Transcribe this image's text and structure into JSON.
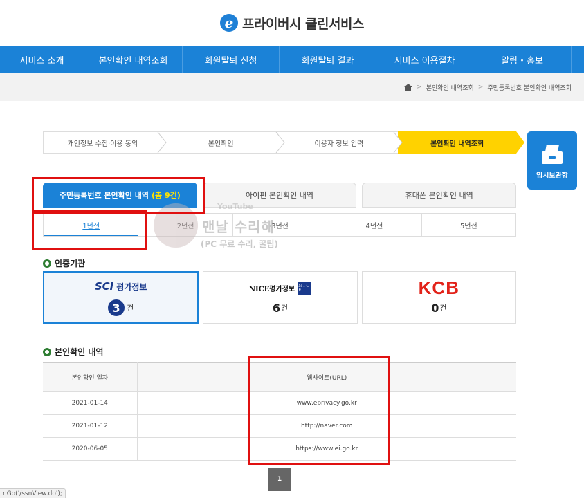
{
  "header": {
    "logo_letter": "e",
    "site_title": "프라이버시 클린서비스"
  },
  "nav": {
    "items": [
      "서비스 소개",
      "본인확인 내역조회",
      "회원탈퇴 신청",
      "회원탈퇴 결과",
      "서비스 이용절차",
      "알림・홍보"
    ]
  },
  "breadcrumb": {
    "items": [
      "본인확인 내역조회",
      "주민등록번호 본인확인 내역조회"
    ]
  },
  "steps": [
    "개인정보 수집·이용 동의",
    "본인확인",
    "이용자 정보 입력",
    "본인확인 내역조회"
  ],
  "side_box": {
    "label": "임시보관함",
    "icon": "drawer-icon"
  },
  "tabs": {
    "t1": "주민등록번호 본인확인 내역",
    "t1_count": "(총 9건)",
    "t2": "아이핀 본인확인 내역",
    "t3": "휴대폰 본인확인 내역"
  },
  "years": [
    "1년전",
    "2년전",
    "3년전",
    "4년전",
    "5년전"
  ],
  "watermark": {
    "top": "YouTube",
    "title": "맨날 수리해",
    "sub": "(PC 무료 수리, 꿀팁)"
  },
  "agency_section": {
    "title": "인증기관"
  },
  "agencies": {
    "sci": {
      "mark": "SCI",
      "name": "평가정보",
      "count": "3",
      "unit": "건"
    },
    "nice": {
      "name": "NICE평가정보",
      "box": "N I C E",
      "count": "6",
      "unit": "건"
    },
    "kcb": {
      "name": "KCB",
      "count": "0",
      "unit": "건"
    }
  },
  "history_section": {
    "title": "본인확인 내역"
  },
  "history": {
    "col_date": "본인확인 일자",
    "col_url": "웹사이트(URL)",
    "rows": [
      {
        "date": "2021-01-14",
        "url": "www.eprivacy.go.kr"
      },
      {
        "date": "2021-01-12",
        "url": "http://naver.com"
      },
      {
        "date": "2020-06-05",
        "url": "https://www.ei.go.kr"
      }
    ]
  },
  "pagination": {
    "current": "1"
  },
  "status_bar": {
    "text": "nGo('/ssnView.do');"
  },
  "colors": {
    "primary": "#1b82d7",
    "highlight": "#ffd200",
    "annotation": "#e01010",
    "count_accent": "#ffe400"
  }
}
